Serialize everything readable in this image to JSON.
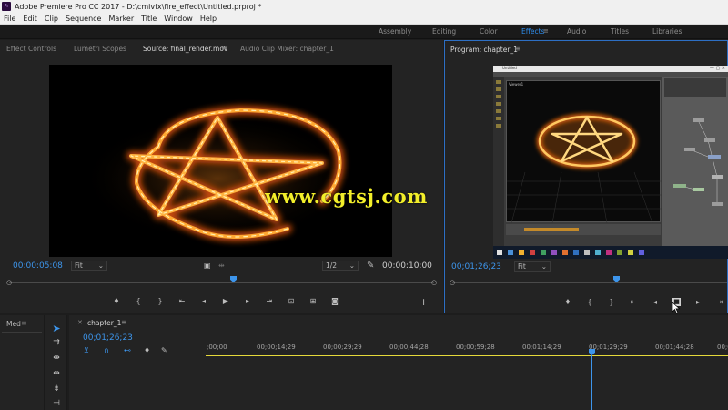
{
  "window": {
    "title": "Adobe Premiere Pro CC 2017 - D:\\cmivfx\\fire_effect\\Untitled.prproj *",
    "app_icon_text": "Pr"
  },
  "menu": [
    "File",
    "Edit",
    "Clip",
    "Sequence",
    "Marker",
    "Title",
    "Window",
    "Help"
  ],
  "workspaces": {
    "items": [
      "Assembly",
      "Editing",
      "Color",
      "Effects",
      "Audio",
      "Titles",
      "Libraries"
    ],
    "active": "Effects",
    "menu_icon": "≡"
  },
  "source_panel": {
    "tabs": [
      "Effect Controls",
      "Lumetri Scopes",
      "Source: final_render.mov",
      "Audio Clip Mixer: chapter_1"
    ],
    "active_tab": "Source: final_render.mov",
    "timecode": "00:00:05:08",
    "fit": "Fit",
    "resolution": "1/2",
    "duration": "00:00:10:00"
  },
  "program_panel": {
    "tab": "Program: chapter_1",
    "timecode": "00;01;26;23",
    "fit": "Fit",
    "inner_window_title": "Untitled",
    "inner_viewer_label": "Viewer1"
  },
  "media_panel": {
    "label": "Med"
  },
  "timeline": {
    "sequence_tab": "chapter_1",
    "timecode": "00;01;26;23",
    "ruler": [
      ";00;00",
      "00;00;14;29",
      "00;00;29;29",
      "00;00;44;28",
      "00;00;59;28",
      "00;01;14;29",
      "00;01;29;29",
      "00;01;44;28",
      "00;0"
    ]
  },
  "watermark": "www.cgtsj.com",
  "colors": {
    "accent": "#2d8ceb",
    "work_area": "#e5d93a",
    "panel_bg": "#232323",
    "border_active": "#2d6fc4"
  }
}
